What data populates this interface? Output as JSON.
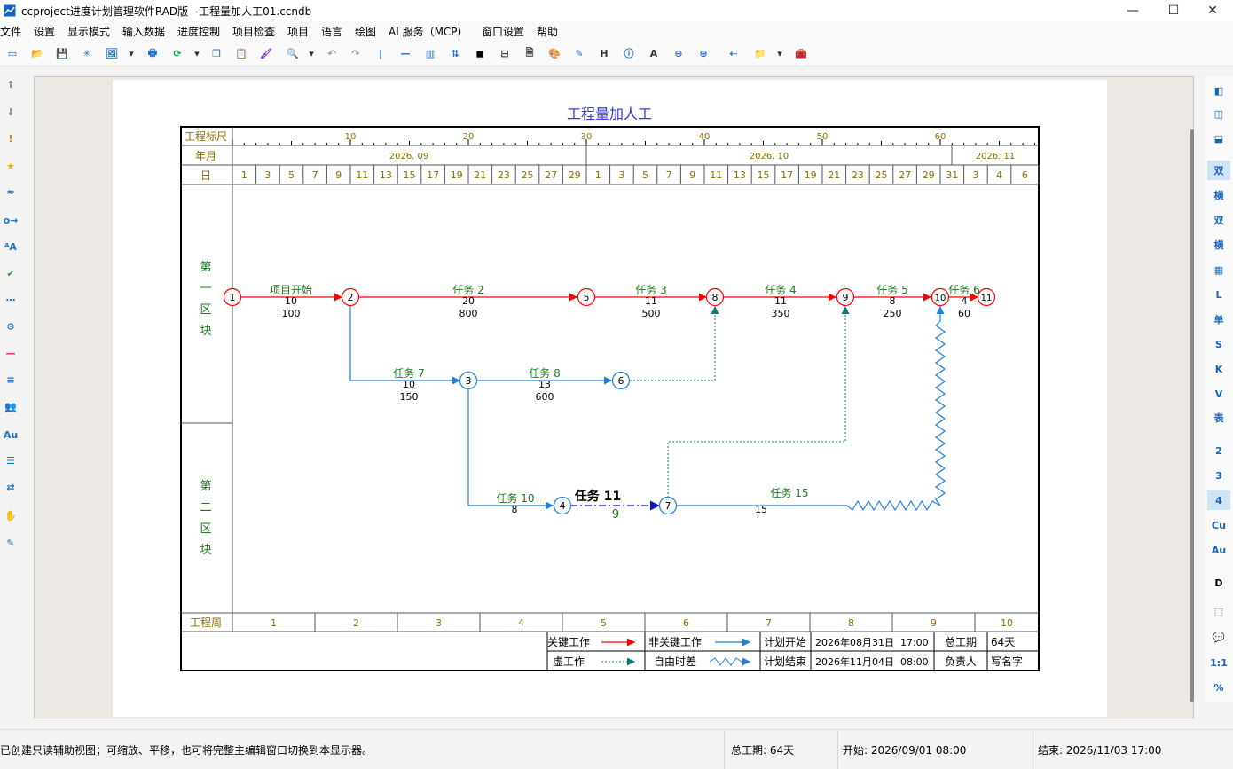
{
  "window": {
    "title": "ccproject进度计划管理软件RAD版 - 工程量加人工01.ccndb",
    "minimize": "—",
    "maximize": "☐",
    "close": "✕"
  },
  "menu": [
    "文件",
    "设置",
    "显示模式",
    "输入数据",
    "进度控制",
    "项目检查",
    "项目",
    "语言",
    "绘图",
    "AI 服务（MCP)",
    "窗口设置",
    "帮助"
  ],
  "toolbar_icons": [
    "new-icon",
    "open-icon",
    "save-icon",
    "star-burst-icon",
    "image-icon",
    "dropdown-icon",
    "print-icon",
    "refresh-icon",
    "dropdown-icon",
    "copy-icon",
    "paste-icon",
    "brush-icon",
    "search-icon",
    "dropdown-icon",
    "undo-icon",
    "redo-icon",
    "vertical-line-icon",
    "horizontal-line-icon",
    "columns-icon",
    "sort-icon",
    "grid-icon",
    "tag-icon",
    "report-icon",
    "palette-icon",
    "note-icon",
    "heading-icon",
    "info-icon",
    "font-icon",
    "zoom-out-icon",
    "zoom-in-icon",
    "arrow-left-icon",
    "folder-icon",
    "dropdown-icon",
    "toolbox-icon"
  ],
  "toolbar_glyphs": [
    "▭",
    "📂",
    "💾",
    "✳",
    "🖼",
    "▾",
    "🖶",
    "⟳",
    "▾",
    "❐",
    "📋",
    "🖌",
    "🔍",
    "▾",
    "↶",
    "↷",
    "|",
    "—",
    "▥",
    "⇅",
    "◼",
    "⊟",
    "🗎",
    "🎨",
    "✎",
    "H",
    "ⓘ",
    "A",
    "⊖",
    "⊕",
    "⇠",
    "📁",
    "▾",
    "🧰"
  ],
  "left_tools": [
    {
      "icon": "arrow-up-icon",
      "glyph": "↑"
    },
    {
      "icon": "arrow-down-icon",
      "glyph": "↓"
    },
    {
      "icon": "exclamation-icon",
      "glyph": "!"
    },
    {
      "icon": "star-icon",
      "glyph": "★"
    },
    {
      "icon": "wave-icon",
      "glyph": "≈"
    },
    {
      "icon": "link-icon",
      "glyph": "o→"
    },
    {
      "icon": "text-a-icon",
      "glyph": "ᴬA"
    },
    {
      "icon": "check-icon",
      "glyph": "✔"
    },
    {
      "icon": "dotted-line-icon",
      "glyph": "⋯"
    },
    {
      "icon": "gear-icon",
      "glyph": "⚙"
    },
    {
      "icon": "red-line-icon",
      "glyph": "—"
    },
    {
      "icon": "list-sort-icon",
      "glyph": "≡"
    },
    {
      "icon": "people-icon",
      "glyph": "👥"
    },
    {
      "icon": "au-icon",
      "glyph": "Au"
    },
    {
      "icon": "filter-icon",
      "glyph": "☰"
    },
    {
      "icon": "swap-icon",
      "glyph": "⇄"
    },
    {
      "icon": "hand-icon",
      "glyph": "✋"
    },
    {
      "icon": "pen-icon",
      "glyph": "✎"
    }
  ],
  "right_tools": [
    {
      "icon": "panel-left-icon",
      "glyph": "◧",
      "sel": false
    },
    {
      "icon": "panel-center-icon",
      "glyph": "◫",
      "sel": false
    },
    {
      "icon": "panel-bottom-icon",
      "glyph": "⬓",
      "sel": false
    },
    {
      "icon": "double-text-icon",
      "glyph": "双",
      "sel": true
    },
    {
      "icon": "horizontal-text-icon",
      "glyph": "横",
      "sel": false
    },
    {
      "icon": "double-add-icon",
      "glyph": "双",
      "sel": false
    },
    {
      "icon": "horizontal-add-icon",
      "glyph": "横",
      "sel": false
    },
    {
      "icon": "table-icon",
      "glyph": "▦",
      "sel": false
    },
    {
      "icon": "l-icon",
      "glyph": "L",
      "sel": false
    },
    {
      "icon": "single-icon",
      "glyph": "单",
      "sel": false
    },
    {
      "icon": "s-icon",
      "glyph": "S",
      "sel": false
    },
    {
      "icon": "k-icon",
      "glyph": "K",
      "sel": false
    },
    {
      "icon": "v-icon",
      "glyph": "V",
      "sel": false
    },
    {
      "icon": "table-text-icon",
      "glyph": "表",
      "sel": false
    },
    {
      "icon": "level-2-icon",
      "glyph": "2",
      "sel": false
    },
    {
      "icon": "level-3-icon",
      "glyph": "3",
      "sel": false
    },
    {
      "icon": "level-4-icon",
      "glyph": "4",
      "sel": true
    },
    {
      "icon": "cu-icon",
      "glyph": "Cu",
      "sel": false
    },
    {
      "icon": "au-icon",
      "glyph": "Au",
      "sel": false
    },
    {
      "icon": "d-icon",
      "glyph": "D",
      "sel": false
    },
    {
      "icon": "dotted-box-icon",
      "glyph": "⬚",
      "sel": false
    },
    {
      "icon": "comment-icon",
      "glyph": "💬",
      "sel": false
    },
    {
      "icon": "ratio-icon",
      "glyph": "1:1",
      "sel": false
    },
    {
      "icon": "percent-icon",
      "glyph": "%",
      "sel": false
    }
  ],
  "chart": {
    "title": "工程量加人工",
    "row_labels": {
      "ruler": "工程标尺",
      "month": "年月",
      "day": "日",
      "week": "工程周"
    },
    "ruler_ticks": [
      "10",
      "20",
      "30",
      "40",
      "50",
      "60"
    ],
    "months": [
      "2026. 09",
      "2026. 10",
      "2026. 11"
    ],
    "days": [
      "1",
      "3",
      "5",
      "7",
      "9",
      "11",
      "13",
      "15",
      "17",
      "19",
      "21",
      "23",
      "25",
      "27",
      "29",
      "1",
      "3",
      "5",
      "7",
      "9",
      "11",
      "13",
      "15",
      "17",
      "19",
      "21",
      "23",
      "25",
      "27",
      "29",
      "31",
      "3",
      "4",
      "6"
    ],
    "weeks": [
      "1",
      "2",
      "3",
      "4",
      "5",
      "6",
      "7",
      "8",
      "9",
      "10"
    ],
    "zones": [
      {
        "chars": [
          "第",
          "一",
          "区",
          "块"
        ]
      },
      {
        "chars": [
          "第",
          "二",
          "区",
          "块"
        ]
      }
    ],
    "nodes": [
      "1",
      "2",
      "3",
      "4",
      "5",
      "6",
      "7",
      "8",
      "9",
      "10",
      "11"
    ],
    "tasks": [
      {
        "name": "项目开始",
        "duration": "10",
        "quantity": "100",
        "kind": "critical"
      },
      {
        "name": "任务 2",
        "duration": "20",
        "quantity": "800",
        "kind": "critical"
      },
      {
        "name": "任务 3",
        "duration": "11",
        "quantity": "500",
        "kind": "critical"
      },
      {
        "name": "任务 4",
        "duration": "11",
        "quantity": "350",
        "kind": "critical"
      },
      {
        "name": "任务 5",
        "duration": "8",
        "quantity": "250",
        "kind": "critical"
      },
      {
        "name": "任务 6",
        "duration": "4",
        "quantity": "60",
        "kind": "critical"
      },
      {
        "name": "任务 7",
        "duration": "10",
        "quantity": "150",
        "kind": "normal"
      },
      {
        "name": "任务 8",
        "duration": "13",
        "quantity": "600",
        "kind": "normal"
      },
      {
        "name": "任务 10",
        "duration": "8",
        "quantity": "",
        "kind": "normal"
      },
      {
        "name": "任务 11",
        "duration": "9",
        "quantity": "",
        "kind": "selected"
      },
      {
        "name": "任务 15",
        "duration": "15",
        "quantity": "",
        "kind": "normal"
      }
    ],
    "legend": {
      "critical": "关键工作",
      "noncritical": "非关键工作",
      "dummy": "虚工作",
      "float": "自由时差",
      "plan_start_label": "计划开始",
      "plan_start": "2026年08月31日  17:00",
      "plan_end_label": "计划结束",
      "plan_end": "2026年11月04日  08:00",
      "total_label": "总工期",
      "total": "64天",
      "owner_label": "负责人",
      "owner": "写名字"
    }
  },
  "status": {
    "message": "已创建只读辅助视图；可缩放、平移，也可将完整主编辑窗口切换到本显示器。",
    "total": "总工期: 64天",
    "start": "开始: 2026/09/01 08:00",
    "end": "结束: 2026/11/03 17:00"
  },
  "colors": {
    "critical": "#ff0000",
    "normal": "#1c7fe0",
    "dummy": "#0b7a7a",
    "task_text": "#1a7a1a",
    "scale_text": "#8a7000",
    "title": "#3a3ad0",
    "selected": "#1010d0"
  }
}
